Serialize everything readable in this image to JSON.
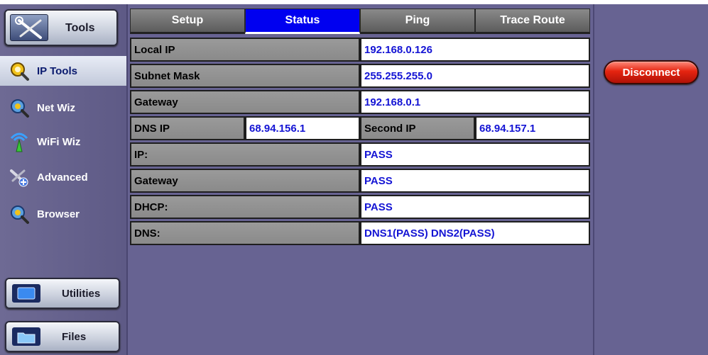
{
  "sidebar": {
    "tools_label": "Tools",
    "items": [
      {
        "label": "IP Tools",
        "icon": "ip-tools-icon",
        "active": true
      },
      {
        "label": "Net Wiz",
        "icon": "net-wiz-icon"
      },
      {
        "label": "WiFi Wiz",
        "icon": "wifi-icon"
      },
      {
        "label": "Advanced",
        "icon": "advanced-icon"
      },
      {
        "label": "Browser",
        "icon": "browser-icon"
      }
    ],
    "utilities_label": "Utilities",
    "files_label": "Files"
  },
  "tabs": [
    {
      "label": "Setup"
    },
    {
      "label": "Status",
      "active": true
    },
    {
      "label": "Ping"
    },
    {
      "label": "Trace Route"
    }
  ],
  "status": {
    "local_ip_label": "Local IP",
    "local_ip": "192.168.0.126",
    "subnet_mask_label": "Subnet Mask",
    "subnet_mask": "255.255.255.0",
    "gateway_label": "Gateway",
    "gateway": "192.168.0.1",
    "dns_ip_label": "DNS IP",
    "dns_ip": "68.94.156.1",
    "second_ip_label": "Second IP",
    "second_ip": "68.94.157.1",
    "ip_check_label": "IP:",
    "ip_check": "PASS",
    "gateway_check_label": "Gateway",
    "gateway_check": "PASS",
    "dhcp_check_label": "DHCP:",
    "dhcp_check": "PASS",
    "dns_check_label": "DNS:",
    "dns_check": "DNS1(PASS) DNS2(PASS)"
  },
  "actions": {
    "disconnect_label": "Disconnect"
  },
  "colors": {
    "panel": "#676392",
    "value_text": "#1414d4",
    "active_tab": "#0000f0",
    "disconnect": "#e52410"
  }
}
